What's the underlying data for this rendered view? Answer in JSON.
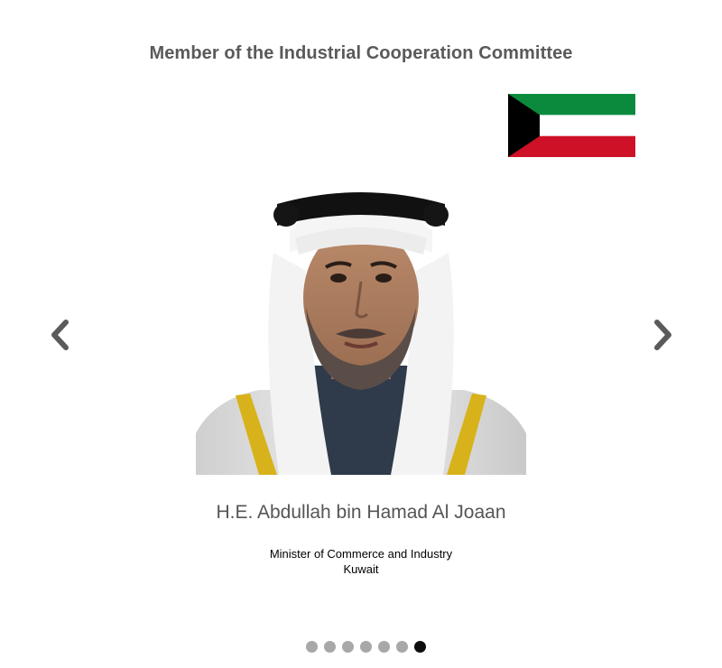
{
  "section": {
    "heading": "Member of the Industrial Cooperation Committee"
  },
  "member": {
    "name": "H.E. Abdullah bin Hamad Al Joaan",
    "role": "Minister of Commerce and Industry",
    "country": "Kuwait"
  },
  "flag": {
    "icon": "kuwait-flag",
    "colors": {
      "green": "#0b8a3e",
      "white": "#ffffff",
      "red": "#ce1126",
      "black": "#000000"
    }
  },
  "navigation": {
    "prev_icon": "chevron-left-icon",
    "next_icon": "chevron-right-icon",
    "arrow_color": "#5b5b5b"
  },
  "pagination": {
    "total": 7,
    "active_index": 6,
    "inactive_color": "#a8a8a8",
    "active_color": "#0d0d0d"
  }
}
